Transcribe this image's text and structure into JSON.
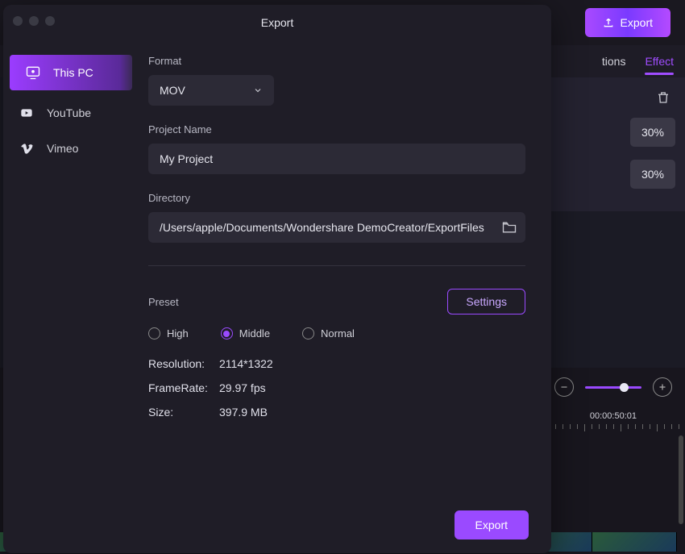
{
  "backdrop": {
    "export_button": "Export",
    "tabs": {
      "tions": "tions",
      "effect": "Effect"
    },
    "percent_values": [
      "30%",
      "30%"
    ],
    "timecode": "00:00:50:01"
  },
  "modal": {
    "title": "Export",
    "sidebar": [
      {
        "label": "This PC",
        "icon": "pc-icon",
        "active": true
      },
      {
        "label": "YouTube",
        "icon": "youtube-icon",
        "active": false
      },
      {
        "label": "Vimeo",
        "icon": "vimeo-icon",
        "active": false
      }
    ],
    "format_label": "Format",
    "format_value": "MOV",
    "project_name_label": "Project Name",
    "project_name_value": "My Project",
    "directory_label": "Directory",
    "directory_value": "/Users/apple/Documents/Wondershare DemoCreator/ExportFiles",
    "preset_label": "Preset",
    "settings_button": "Settings",
    "presets": [
      {
        "label": "High",
        "selected": false
      },
      {
        "label": "Middle",
        "selected": true
      },
      {
        "label": "Normal",
        "selected": false
      }
    ],
    "info": {
      "resolution_label": "Resolution:",
      "resolution_value": "2114*1322",
      "framerate_label": "FrameRate:",
      "framerate_value": "29.97 fps",
      "size_label": "Size:",
      "size_value": "397.9 MB"
    },
    "export_button": "Export"
  }
}
